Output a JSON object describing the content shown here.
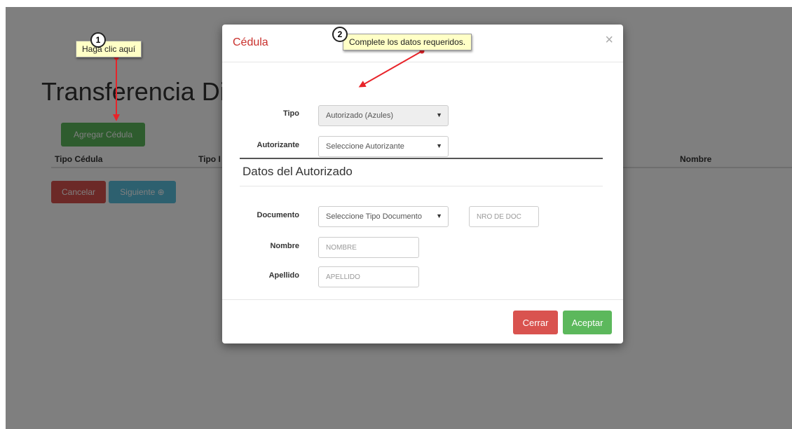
{
  "background_page": {
    "title": "Transferencia Dig",
    "add_button_label": "Agregar Cédula",
    "table_headers": [
      "Tipo Cédula",
      "Tipo I",
      "Nombre"
    ],
    "cancel_button_label": "Cancelar",
    "next_button_label": "Siguiente ⊕"
  },
  "modal": {
    "title": "Cédula",
    "close_symbol": "×",
    "fields": {
      "tipo_label": "Tipo",
      "tipo_value": "Autorizado (Azules)",
      "autorizante_label": "Autorizante",
      "autorizante_value": "Seleccione Autorizante",
      "section_title": "Datos del Autorizado",
      "documento_label": "Documento",
      "documento_value": "Seleccione Tipo Documento",
      "nro_doc_placeholder": "NRO DE DOC",
      "nombre_label": "Nombre",
      "nombre_placeholder": "NOMBRE",
      "apellido_label": "Apellido",
      "apellido_placeholder": "APELLIDO"
    },
    "footer": {
      "cerrar_label": "Cerrar",
      "aceptar_label": "Aceptar"
    }
  },
  "callouts": [
    {
      "step": "1",
      "text": "Haga clic aquí"
    },
    {
      "step": "2",
      "text": "Complete los datos requeridos."
    }
  ],
  "colors": {
    "arrow_red": "#e8242a",
    "callout_yellow": "#ffffc6",
    "success_green": "#5cb85c",
    "danger_red": "#d9534f",
    "info_blue": "#5bc0de",
    "modal_title_red": "#c9302c"
  }
}
